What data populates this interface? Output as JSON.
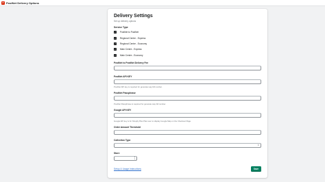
{
  "app": {
    "name": "PostNet Delivery Options",
    "logo_letter": "P"
  },
  "settings": {
    "title": "Delivery Settings",
    "subtitle": "Set up delivery options",
    "service_type": {
      "label": "Service Type",
      "options": [
        {
          "label": "PostNet to PostNet",
          "checked": true
        },
        {
          "label": "Regional Centre - Express",
          "checked": true
        },
        {
          "label": "Regional Centre - Economy",
          "checked": true
        },
        {
          "label": "Main Centre - Express",
          "checked": true
        },
        {
          "label": "Main Centre - Economy",
          "checked": true
        }
      ]
    },
    "fields": {
      "delivery_fee": {
        "label": "PostNet to PostNet Delivery Fee",
        "value": ""
      },
      "api_key": {
        "label": "PostNet API KEY",
        "value": "",
        "help": "PostNet API key is required for generate way bill number."
      },
      "passphrase": {
        "label": "PostNet Passphrase",
        "value": "",
        "help": "PostNet Passphrase is required for generate way bill number."
      },
      "google_api_key": {
        "label": "Google API KEY",
        "value": "",
        "help": "Google API key is for Shopify Plus Plan user to display Google Map on the Checkout Page."
      },
      "order_threshold": {
        "label": "Order Amount Threshold",
        "value": ""
      },
      "collection_type": {
        "label": "Collection Type",
        "value": ""
      },
      "store": {
        "label": "Store",
        "value": ""
      }
    },
    "setup_link": "Setup & Usage Instructions",
    "save_label": "Save"
  }
}
